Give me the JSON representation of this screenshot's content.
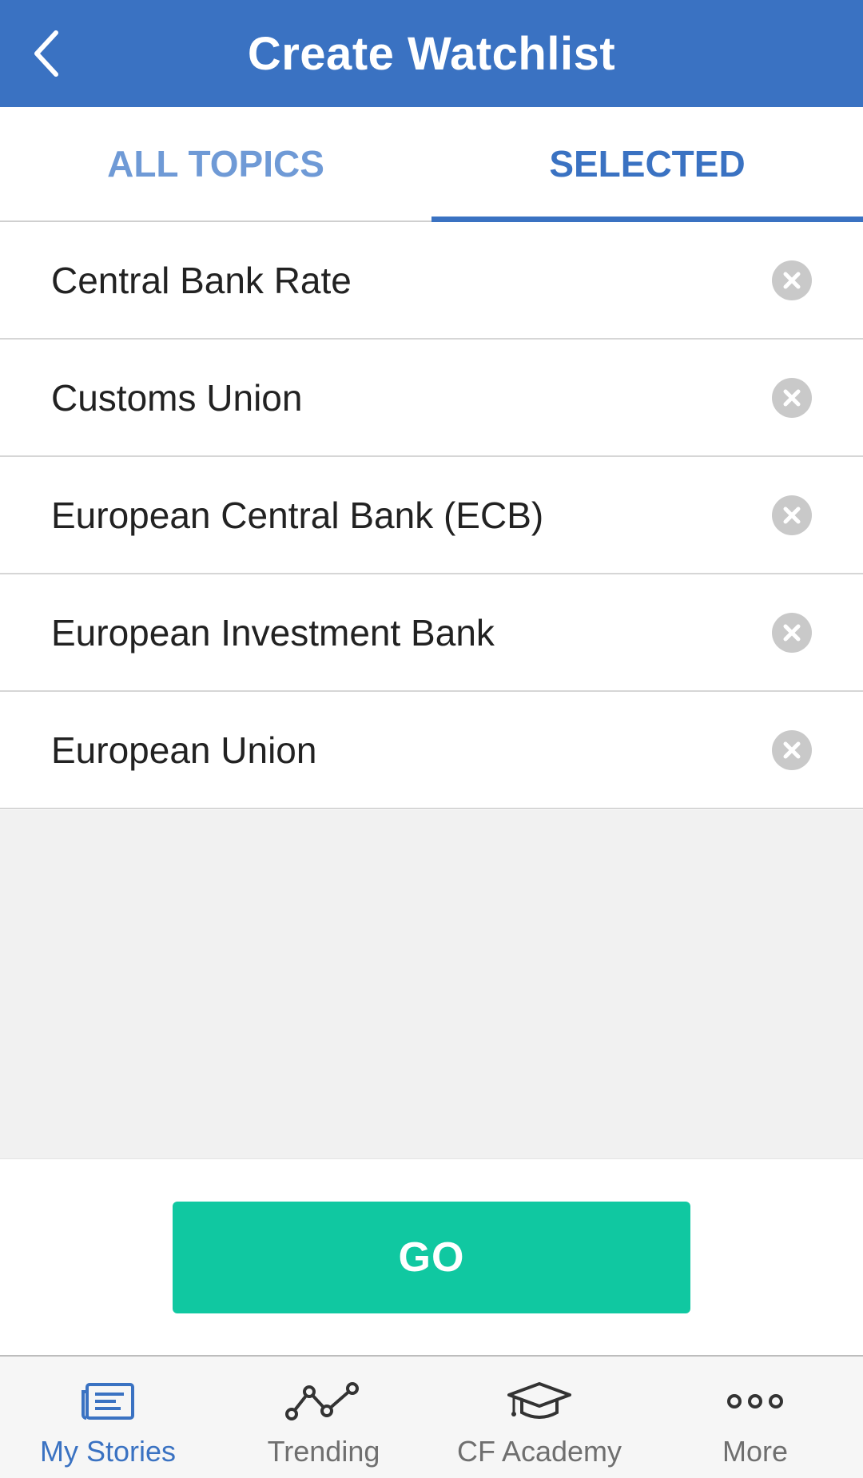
{
  "header": {
    "title": "Create Watchlist",
    "back_icon": "chevron-left-icon"
  },
  "tabs": [
    {
      "label": "ALL TOPICS",
      "active": false
    },
    {
      "label": "SELECTED",
      "active": true
    }
  ],
  "selected_topics": [
    {
      "label": "Central Bank Rate"
    },
    {
      "label": "Customs Union"
    },
    {
      "label": "European Central Bank (ECB)"
    },
    {
      "label": "European Investment Bank"
    },
    {
      "label": "European Union"
    }
  ],
  "actions": {
    "go_label": "GO"
  },
  "bottom_nav": [
    {
      "label": "My Stories",
      "icon": "news-icon",
      "active": true
    },
    {
      "label": "Trending",
      "icon": "trending-icon",
      "active": false
    },
    {
      "label": "CF Academy",
      "icon": "graduation-cap-icon",
      "active": false
    },
    {
      "label": "More",
      "icon": "more-dots-icon",
      "active": false
    }
  ],
  "colors": {
    "primary": "#3a72c2",
    "tab_inactive": "#6f9ad6",
    "go_button": "#10c8a1",
    "remove_icon": "#c9c9c9",
    "empty_area": "#f1f1f1"
  }
}
